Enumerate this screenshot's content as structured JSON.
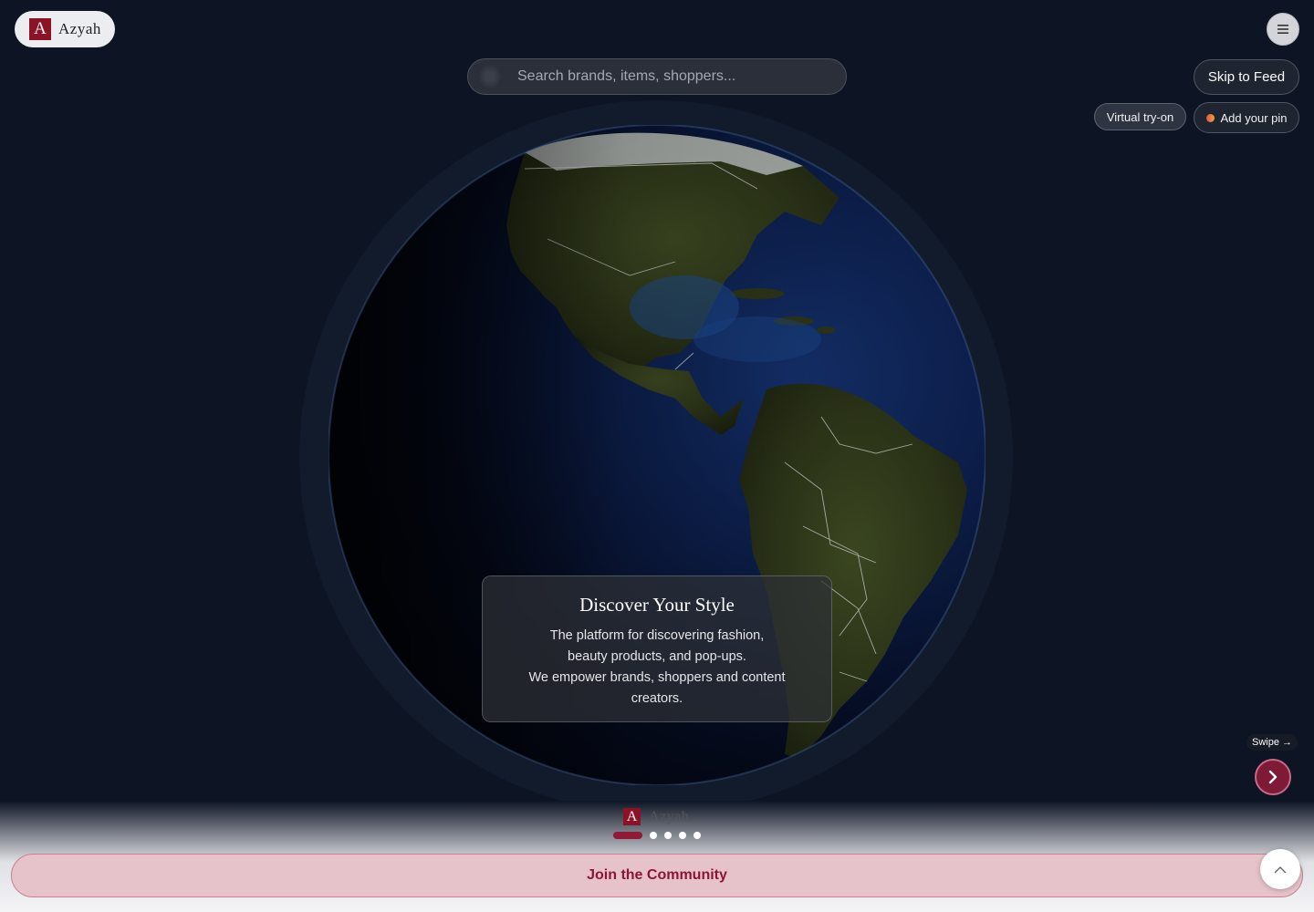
{
  "brand": {
    "name": "Azyah",
    "mark": "A",
    "color": "#8e1226"
  },
  "search": {
    "placeholder": "Search brands, items, shoppers..."
  },
  "header": {
    "menu_icon": "hamburger-icon",
    "skip_label": "Skip to Feed",
    "tryon_label": "Virtual try-on",
    "pin_label": "Add your pin"
  },
  "hero": {
    "title": "Discover Your Style",
    "line1": "The platform for discovering fashion,",
    "line2": "beauty products, and pop-ups.",
    "line3": "We empower brands, shoppers and content creators."
  },
  "carousel": {
    "swipe_label": "Swipe →",
    "next_icon": "chevron-right-icon",
    "slide_count": 5,
    "active_index": 0
  },
  "footer": {
    "join_label": "Join the Community",
    "scroll_top_icon": "chevron-up-icon"
  },
  "colors": {
    "background": "#0d1424",
    "accent": "#8e1a36",
    "join_bg": "#e6c3ca"
  }
}
